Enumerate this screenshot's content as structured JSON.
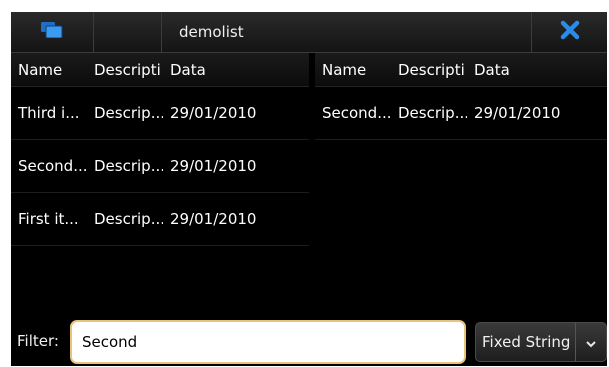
{
  "window": {
    "title": "demolist"
  },
  "icons": {
    "menu": "task-switcher-icon",
    "close": "close-icon",
    "dropdown": "chevron-down-icon"
  },
  "colors": {
    "accent": "#2f8fe8",
    "close": "#2a8be8",
    "input_border": "#e8c37a"
  },
  "left_table": {
    "headers": [
      "Name",
      "Descripti",
      "Data"
    ],
    "rows": [
      [
        "Third i...",
        "Descrip...",
        "29/01/2010"
      ],
      [
        "Second...",
        "Descrip...",
        "29/01/2010"
      ],
      [
        "First it...",
        "Descrip...",
        "29/01/2010"
      ]
    ]
  },
  "right_table": {
    "headers": [
      "Name",
      "Descripti",
      "Data"
    ],
    "rows": [
      [
        "Second...",
        "Descrip...",
        "29/01/2010"
      ]
    ]
  },
  "filter": {
    "label": "Filter:",
    "value": "Second",
    "mode": "Fixed String"
  }
}
